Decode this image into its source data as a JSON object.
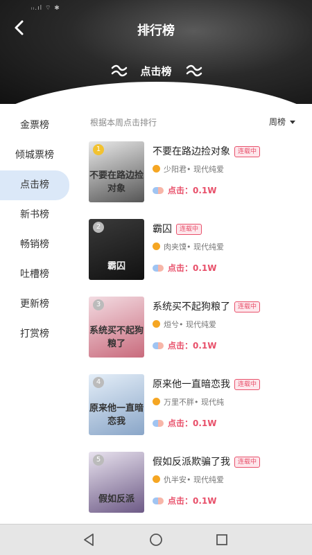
{
  "status_bar": {
    "text": "ᵢᵢ.ıl ⌔ ✱"
  },
  "header": {
    "title": "排行榜",
    "rank_type": "点击榜"
  },
  "sidebar": {
    "items": [
      {
        "label": "金票榜"
      },
      {
        "label": "倾城票榜"
      },
      {
        "label": "点击榜",
        "active": true
      },
      {
        "label": "新书榜"
      },
      {
        "label": "畅销榜"
      },
      {
        "label": "吐槽榜"
      },
      {
        "label": "更新榜"
      },
      {
        "label": "打赏榜"
      }
    ]
  },
  "list": {
    "subtitle": "根据本周点击排行",
    "period": "周榜",
    "books": [
      {
        "rank": "1",
        "title": "不要在路边捡对象",
        "tag": "连载中",
        "author_genre": "少阳君• 现代纯爱",
        "clicks": "点击：0.1W",
        "cover_text": "不要在路边捡对象",
        "cover_colors": [
          "#e9e9e9",
          "#555"
        ]
      },
      {
        "rank": "2",
        "title": "霸囚",
        "tag": "连载中",
        "author_genre": "肉夹馍• 现代纯爱",
        "clicks": "点击：0.1W",
        "cover_text": "霸囚",
        "cover_colors": [
          "#3a3a3a",
          "#111"
        ]
      },
      {
        "rank": "3",
        "title": "系统买不起狗粮了",
        "tag": "连载中",
        "author_genre": "烜兮• 现代纯爱",
        "clicks": "点击：0.1W",
        "cover_text": "系统买不起狗粮了",
        "cover_colors": [
          "#f3dce2",
          "#c96b7d"
        ]
      },
      {
        "rank": "4",
        "title": "原来他一直暗恋我",
        "tag": "连载中",
        "author_genre": "万里不胖• 现代纯",
        "clicks": "点击：0.1W",
        "cover_text": "原来他一直暗恋我",
        "cover_colors": [
          "#e4eef8",
          "#8aa6c8"
        ]
      },
      {
        "rank": "5",
        "title": "假如反派欺骗了我",
        "tag": "连载中",
        "author_genre": "仇半安• 现代纯爱",
        "clicks": "点击：0.1W",
        "cover_text": "假如反派",
        "cover_colors": [
          "#e8e2ee",
          "#6d5a86"
        ]
      }
    ]
  },
  "colors": {
    "accent": "#e8506a",
    "active_bg": "#dbe8f8",
    "badge_gold": "#f2c230"
  }
}
